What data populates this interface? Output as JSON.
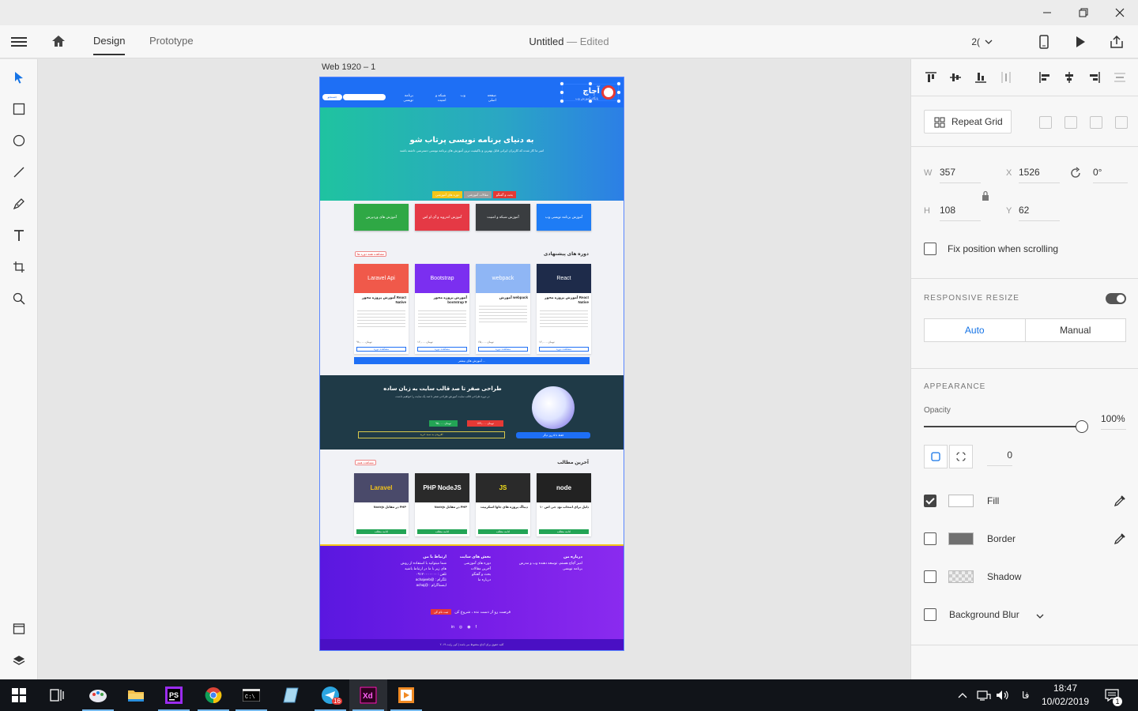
{
  "window": {
    "controls": [
      "minimize",
      "restore",
      "close"
    ]
  },
  "menubar": {
    "tabs": [
      {
        "label": "Design",
        "active": true
      },
      {
        "label": "Prototype",
        "active": false
      }
    ],
    "doc_title": "Untitled",
    "doc_separator": "—",
    "doc_status": "Edited",
    "zoom": "2("
  },
  "tools": [
    "select-arrow",
    "rectangle",
    "ellipse",
    "line",
    "pen",
    "text",
    "artboard",
    "zoom"
  ],
  "canvas": {
    "artboard_label": "Web 1920 – 1",
    "site": {
      "nav_links": [
        "صفحه اصلی",
        "وب",
        "شبکه و امنیت",
        "برنامه نویسی"
      ],
      "nav_button": "جستجو",
      "logo_title": "آچاچ",
      "logo_sub": "پایگاه آموزش وب",
      "hero_title": "به دنیای برنامه نویسی پرتاب شو",
      "hero_text": "امیر ما کار شده که کاربران ایرانی قابل بهترین و باکیفیت ترین آموزش های برنامه نویسی دسترسی داشته باشند",
      "hero_buttons": [
        {
          "label": "دوره های آموزشی",
          "color": "#f5c518"
        },
        {
          "label": "مقالات آموزشی",
          "color": "#9e9e9e"
        },
        {
          "label": "بحث و گفتگو",
          "color": "#e53935"
        }
      ],
      "categories": [
        {
          "label": "آموزش های وردپرس",
          "color": "#2fa845"
        },
        {
          "label": "آموزش اندروید و آی او اس",
          "color": "#e53945"
        },
        {
          "label": "آموزش شبکه و امنیت",
          "color": "#3a3d40"
        },
        {
          "label": "آموزش برنامه نویسی وب",
          "color": "#1e7cf5"
        }
      ],
      "courses_title": "دوره های پیشنهادی",
      "courses_tag": "مشاهده همه دوره ها",
      "courses": [
        {
          "img": "Laravel Api",
          "color": "#f0594a",
          "title": "آموزش پروژه محور React Native",
          "price": "۹۸,۰۰۰ تومان"
        },
        {
          "img": "Bootstrap",
          "color": "#7b2ff0",
          "title": "آموزش پروژه محور bootstrap ۴",
          "price": "۱۲,۰۰۰ تومان"
        },
        {
          "img": "webpack",
          "color": "#8fb6f5",
          "title": "آموزش webpack",
          "price": "۶۵,۰۰۰ تومان"
        },
        {
          "img": "React",
          "color": "#1e2b4a",
          "title": "آموزش پروژه محور React Native",
          "price": "۱۲,۰۰۰ تومان"
        }
      ],
      "course_button": "مشاهده دوره",
      "all_courses": "آموزش های بیشتر ...",
      "promo_title": "طراحی صفر تا صد قالب سایت به زبان ساده",
      "promo_text": "در دوره طراحی قالب سایت آموزش طراحی صفر تا صد یک سایت را خواهیم داشت",
      "promo_price_old": "۱۷۹,۰۰۰ تومان",
      "promo_price_new": "۹۵,۰۰۰ تومان",
      "promo_bar": "افزودن به سبد خرید",
      "promo_bar2": "فقط تا ۵ روز دیگر",
      "posts_title": "آخرین مطالب",
      "posts_tag": "مشاهده همه",
      "posts": [
        {
          "img": "Laravel",
          "color": "#4a4a6a",
          "text_color": "#f5c518",
          "title": "Nodejs در مقابل PHP"
        },
        {
          "img": "PHP NodeJS",
          "color": "#2a2a2a",
          "text_color": "#ffffff",
          "title": "Nodejs در مقابل PHP"
        },
        {
          "img": "JS",
          "color": "#2a2a2a",
          "text_color": "#f5e11a",
          "title": "دیباگ پروژه های جاوا اسکریپت"
        },
        {
          "img": "node",
          "color": "#222222",
          "text_color": "#ffffff",
          "title": "۱۰ دلیل برای انتخاب نود جی اس"
        }
      ],
      "post_button": "ادامه مطلب",
      "footer": {
        "col_contact_title": "ارتباط با من",
        "col_contact": [
          "شما میتوانید با استفاده از روش های زیر با ما در ارتباط باشید",
          "تلفن : ۰۹۱۲۰۰۰۰۰۰۰",
          "تلگرام : @achajweb",
          "اینستاگرام : @achaj"
        ],
        "col_sections_title": "بخش های سایت",
        "col_sections": [
          "دوره های آموزشی",
          "آخرین مقالات",
          "بحث و گفتگو",
          "درباره ما"
        ],
        "col_about_title": "درباره من",
        "col_about": "امیر آچاچ هستم، توسعه دهنده وب و مدرس برنامه نویسی",
        "cta_text": "فرصت رو از دست نده ، شروع کن",
        "cta_button": "ثبت نام کن",
        "social": [
          "in",
          "◎",
          "◉",
          "f"
        ],
        "copyright": "کلیه حقوق برای آچاچ محفوظ می باشد | کپی رایت ۲۰۱۹"
      }
    }
  },
  "inspector": {
    "repeat_grid": "Repeat Grid",
    "w_label": "W",
    "w_value": "357",
    "x_label": "X",
    "x_value": "1526",
    "h_label": "H",
    "h_value": "108",
    "y_label": "Y",
    "y_value": "62",
    "rotation": "0°",
    "fix_position": "Fix position when scrolling",
    "responsive_heading": "RESPONSIVE RESIZE",
    "responsive_on": true,
    "auto": "Auto",
    "manual": "Manual",
    "appearance_heading": "APPEARANCE",
    "opacity_label": "Opacity",
    "opacity_value": "100%",
    "radius_value": "0",
    "fill": {
      "label": "Fill",
      "checked": true,
      "color": "#ffffff"
    },
    "border": {
      "label": "Border",
      "checked": false,
      "color": "#707070"
    },
    "shadow": {
      "label": "Shadow",
      "checked": false
    },
    "blur": {
      "label": "Background Blur",
      "checked": false
    }
  },
  "taskbar": {
    "apps": [
      "start",
      "task-view",
      "paint",
      "file-explorer",
      "phpstorm",
      "chrome",
      "terminal",
      "notepad",
      "telegram",
      "adobe-xd",
      "media-player"
    ],
    "telegram_badge": "16",
    "lang": "فا",
    "time": "18:47",
    "date": "10/02/2019",
    "notification_count": "1"
  }
}
